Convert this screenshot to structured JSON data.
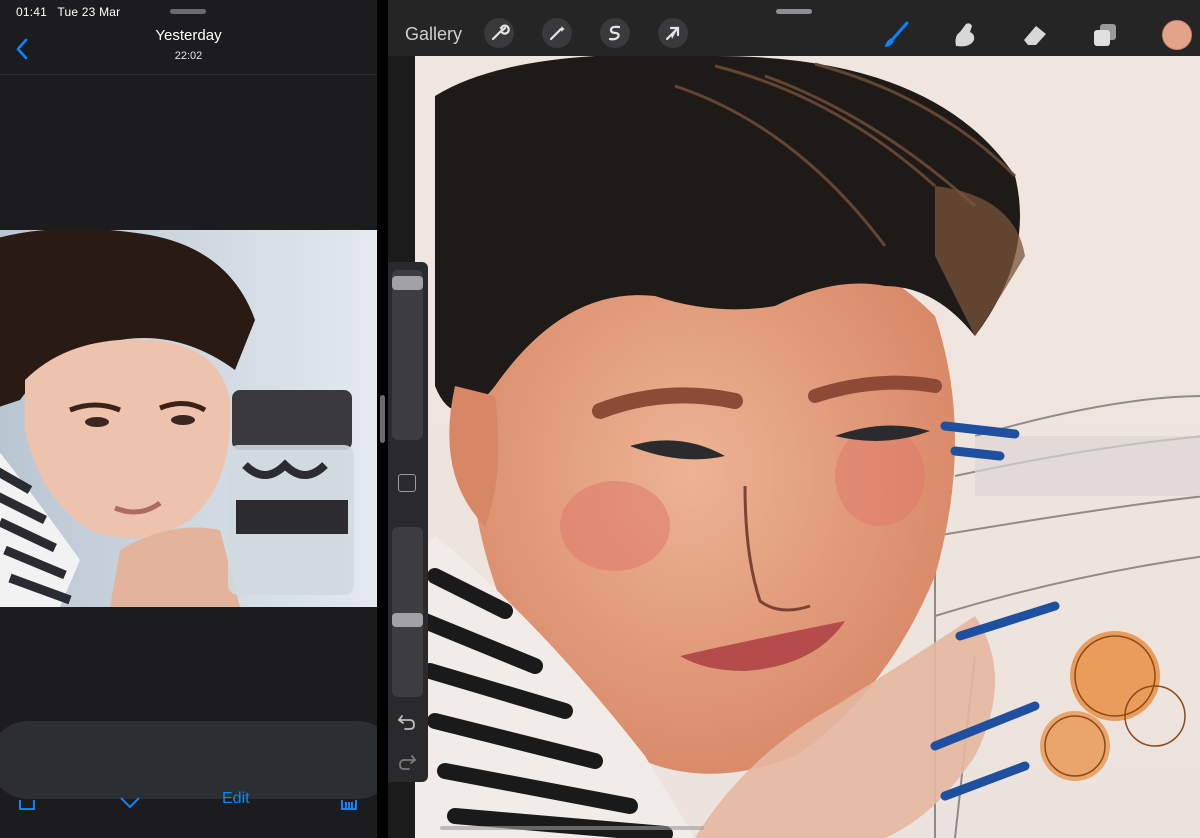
{
  "status_bar": {
    "time": "01:41",
    "date": "Tue 23 Mar"
  },
  "photos": {
    "title": "Yesterday",
    "time": "22:02",
    "bottom_bar": {
      "edit_label": "Edit"
    }
  },
  "procreate": {
    "gallery_label": "Gallery",
    "toolbar_icons": [
      "wrench-icon",
      "magic-wand-icon",
      "selection-icon",
      "transform-icon"
    ],
    "tools": [
      "brush-icon",
      "smudge-icon",
      "eraser-icon",
      "layers-icon"
    ],
    "current_color": "#e2a389",
    "accent": "#0a84ff"
  }
}
